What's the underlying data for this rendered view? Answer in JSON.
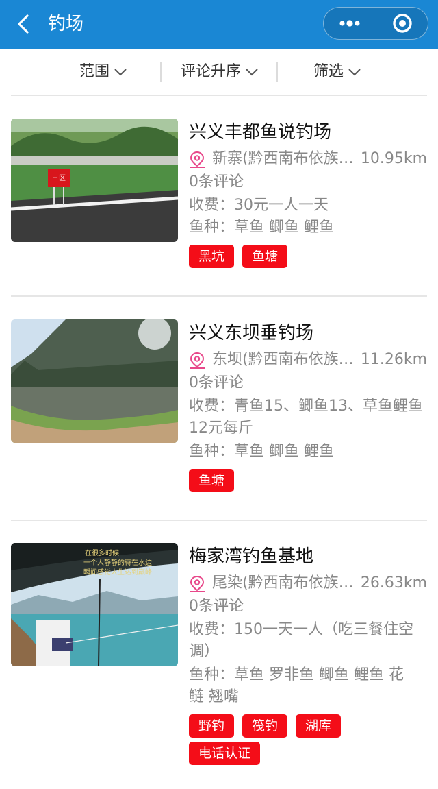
{
  "nav": {
    "title": "钓场",
    "back_icon": "back-arrow-icon",
    "more_icon": "more-dots-icon",
    "close_icon": "target-circle-icon"
  },
  "filters": [
    {
      "label": "范围"
    },
    {
      "label": "评论升序"
    },
    {
      "label": "筛选"
    }
  ],
  "spots": [
    {
      "name": "兴义丰都鱼说钓场",
      "location": "新寨(黔西南布依族苗族自治州兴义市)",
      "distance": "10.95km",
      "comments": "0条评论",
      "fee": "收费：30元一人一天",
      "fish": "鱼种：草鱼 鲫鱼 鲤鱼",
      "tags": [
        "黑坑",
        "鱼塘"
      ],
      "sign_text": "三区"
    },
    {
      "name": "兴义东坝垂钓场",
      "location": "东坝(黔西南布依族苗族自治州兴义市)",
      "distance": "11.26km",
      "comments": "0条评论",
      "fee_line1": "收费：青鱼15、鲫鱼13、草鱼鲤鱼",
      "fee_line2": "12元每斤",
      "fish": "鱼种：草鱼 鲫鱼 鲤鱼",
      "tags": [
        "鱼塘"
      ]
    },
    {
      "name": "梅家湾钓鱼基地",
      "location": "尾染(黔西南布依族苗族自治州兴义市)",
      "distance": "26.63km",
      "comments": "0条评论",
      "fee_line1": "收费：150一天一人（吃三餐住空",
      "fee_line2": "调）",
      "fish_line1": "鱼种：草鱼 罗非鱼 鲫鱼 鲤鱼 花",
      "fish_line2": "鲢 翘嘴",
      "tags": [
        "野钓",
        "筏钓",
        "湖库",
        "电话认证"
      ],
      "photo_caption_1": "在很多时候",
      "photo_caption_2": "一个人静静的待在水边",
      "photo_caption_3": "瞬间感觉人生达到巅峰"
    }
  ],
  "colors": {
    "nav_bg": "#1a87d4",
    "tag_bg": "#f40d18",
    "pin": "#e8488a"
  }
}
